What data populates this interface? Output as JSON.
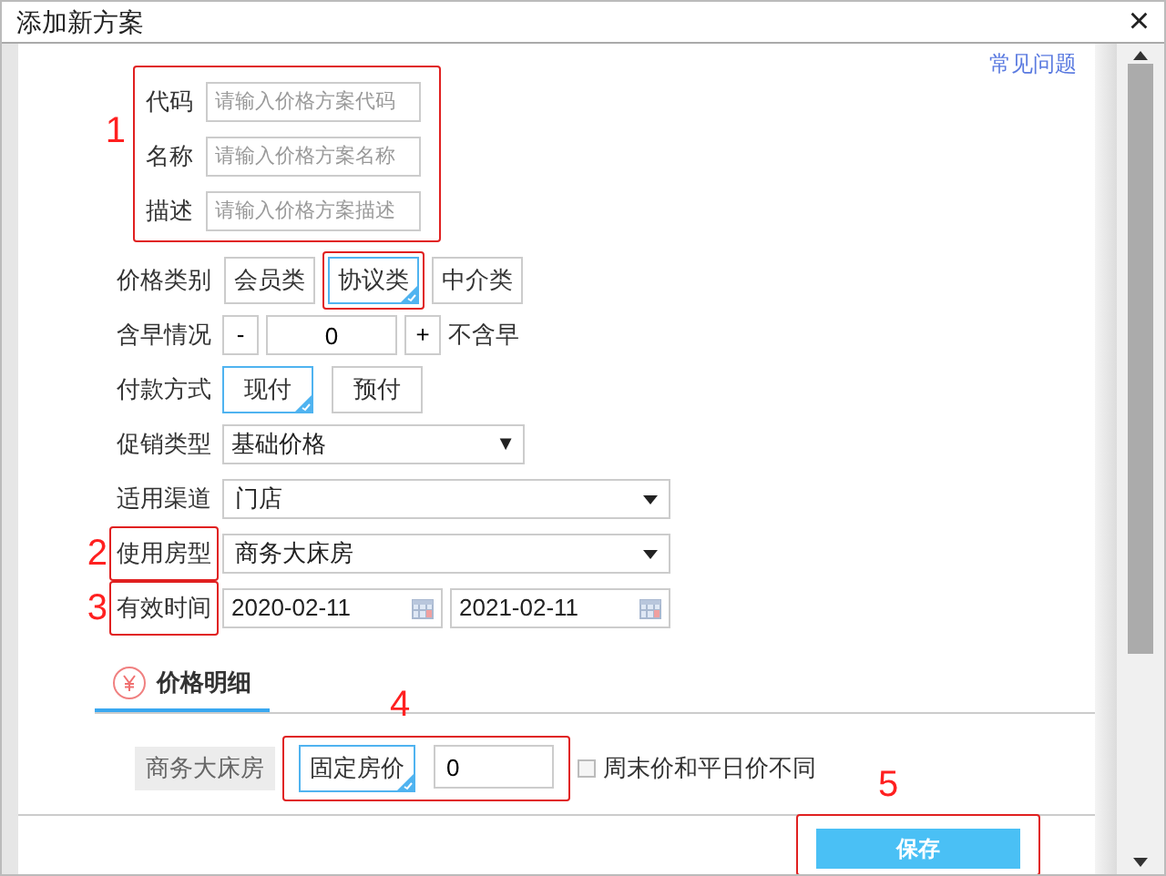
{
  "window": {
    "title": "添加新方案",
    "close": "×"
  },
  "help_link": "常见问题",
  "basic_fields": {
    "annotation": "1",
    "fields": [
      {
        "label": "代码",
        "placeholder": "请输入价格方案代码"
      },
      {
        "label": "名称",
        "placeholder": "请输入价格方案名称"
      },
      {
        "label": "描述",
        "placeholder": "请输入价格方案描述"
      }
    ]
  },
  "price_category": {
    "label": "价格类别",
    "options": [
      {
        "label": "会员类",
        "selected": false,
        "highlighted": false
      },
      {
        "label": "协议类",
        "selected": true,
        "highlighted": true
      },
      {
        "label": "中介类",
        "selected": false,
        "highlighted": false
      }
    ]
  },
  "breakfast": {
    "label": "含早情况",
    "minus": "-",
    "value": "0",
    "plus": "+",
    "note": "不含早"
  },
  "payment": {
    "label": "付款方式",
    "options": [
      {
        "label": "现付",
        "selected": true
      },
      {
        "label": "预付",
        "selected": false
      }
    ]
  },
  "promotion": {
    "label": "促销类型",
    "value": "基础价格",
    "arrow": "▼"
  },
  "channel": {
    "label": "适用渠道",
    "value": "门店"
  },
  "room_type": {
    "label": "使用房型",
    "annotation": "2",
    "value": "商务大床房"
  },
  "valid_time": {
    "label": "有效时间",
    "annotation": "3",
    "start": "2020-02-11",
    "end": "2021-02-11"
  },
  "tabs": [
    {
      "label": "价格明细",
      "selected": true
    }
  ],
  "price_row": {
    "room": "商务大床房",
    "annotation": "4",
    "mode": {
      "label": "固定房价",
      "selected": true
    },
    "price": "0",
    "weekend_diff": {
      "label": "周末价和平日价不同",
      "checked": false
    }
  },
  "footer": {
    "annotation": "5",
    "save": "保存"
  }
}
